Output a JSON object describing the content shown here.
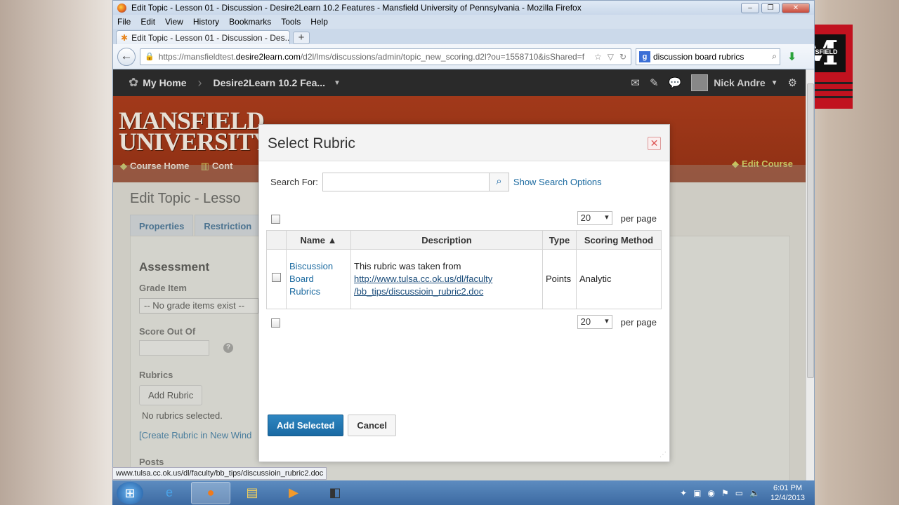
{
  "browser": {
    "window_title": "Edit Topic - Lesson 01 - Discussion - Desire2Learn 10.2 Features - Mansfield University of Pennsylvania - Mozilla Firefox",
    "menu": [
      "File",
      "Edit",
      "View",
      "History",
      "Bookmarks",
      "Tools",
      "Help"
    ],
    "tab_title": "Edit Topic - Lesson 01 - Discussion - Des...",
    "url_prefix": "https://mansfieldtest.",
    "url_domain": "desire2learn.com",
    "url_rest": "/d2l/lms/discussions/admin/topic_new_scoring.d2l?ou=1558710&isShared=f",
    "search_value": "discussion board rubrics",
    "status_url": "www.tulsa.cc.ok.us/dl/faculty/bb_tips/discussioin_rubric2.doc"
  },
  "d2l": {
    "my_home": "My Home",
    "course": "Desire2Learn 10.2 Fea...",
    "user": "Nick Andre",
    "logo_line1": "MANSFIELD",
    "logo_line2": "UNIVERSITY",
    "course_home": "Course Home",
    "content": "Cont",
    "edit_course": "Edit Course",
    "page_title": "Edit Topic - Lesso",
    "tabs": [
      "Properties",
      "Restriction"
    ],
    "assessment": "Assessment",
    "grade_item_label": "Grade Item",
    "grade_item_value": "-- No grade items exist --",
    "score_label": "Score Out Of",
    "rubrics_label": "Rubrics",
    "add_rubric": "Add Rubric",
    "no_rubrics": "No rubrics selected.",
    "create_rubric": "[Create Rubric in New Wind",
    "posts_label": "Posts"
  },
  "modal": {
    "title": "Select Rubric",
    "search_label": "Search For:",
    "search_placeholder": "",
    "show_options": "Show Search Options",
    "per_page_value": "20",
    "per_page_label": "per page",
    "columns": {
      "name": "Name ▲",
      "description": "Description",
      "type": "Type",
      "scoring": "Scoring Method"
    },
    "row": {
      "name_line1": "Biscussion",
      "name_line2": "Board",
      "name_line3": "Rubrics",
      "desc_text": "This rubric was taken from",
      "desc_link1": "http://www.tulsa.cc.ok.us/dl/faculty",
      "desc_link2": "/bb_tips/discussioin_rubric2.doc",
      "type": "Points",
      "scoring": "Analytic"
    },
    "add_selected": "Add Selected",
    "cancel": "Cancel"
  },
  "taskbar": {
    "time": "6:01 PM",
    "date": "12/4/2013"
  },
  "watermark": {
    "label": "MANSFIELD"
  },
  "colors": {
    "banner": "#9a3517",
    "primary_button": "#1f74b0",
    "link": "#1b6aa0"
  }
}
